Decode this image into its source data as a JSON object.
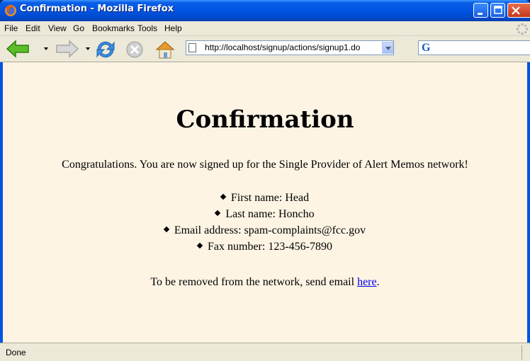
{
  "window": {
    "title": "Confirmation - Mozilla Firefox"
  },
  "menubar": {
    "items": [
      "File",
      "Edit",
      "View",
      "Go",
      "Bookmarks",
      "Tools",
      "Help"
    ]
  },
  "toolbar": {
    "url": "http://localhost/signup/actions/signup1.do",
    "search_engine_icon": "G"
  },
  "icons": {
    "back": "back-arrow-icon",
    "forward": "forward-arrow-icon",
    "reload": "reload-icon",
    "stop": "stop-icon",
    "home": "home-icon"
  },
  "page": {
    "heading": "Confirmation",
    "intro": "Congratulations. You are now signed up for the Single Provider of Alert Memos network!",
    "details": [
      "First name: Head",
      "Last name: Honcho",
      "Email address: spam-complaints@fcc.gov",
      "Fax number: 123-456-7890"
    ],
    "removal_text": "To be removed from the network, send email ",
    "removal_link": "here",
    "removal_suffix": "."
  },
  "status": {
    "text": "Done"
  },
  "colors": {
    "titlebar": "#0054e3",
    "page_background": "#fdf4e4",
    "link": "#0000ee",
    "chrome": "#ece9d8"
  }
}
